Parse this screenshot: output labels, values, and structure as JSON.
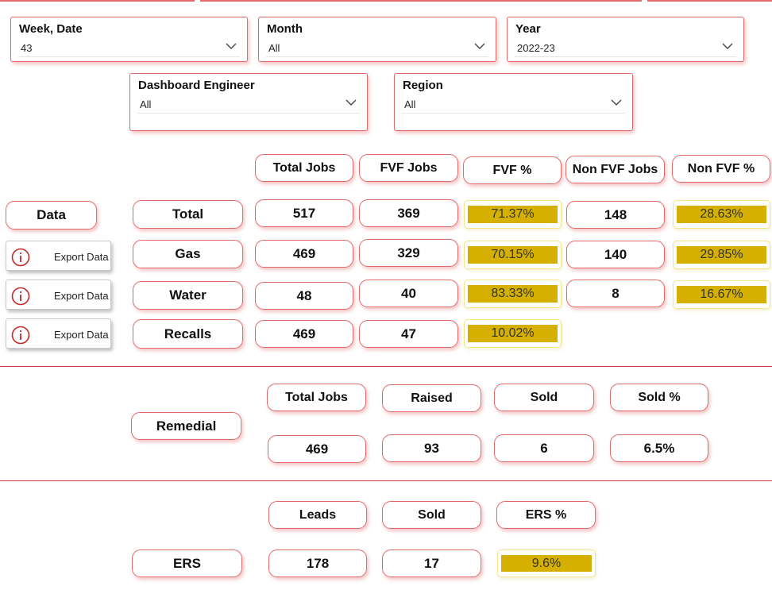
{
  "colors": {
    "accent_red": "#d33a3a",
    "pct_fill": "#d6b000"
  },
  "filters": {
    "week_date": {
      "label": "Week, Date",
      "value": "43"
    },
    "month": {
      "label": "Month",
      "value": "All"
    },
    "year": {
      "label": "Year",
      "value": "2022-23"
    },
    "dashboard_engineer": {
      "label": "Dashboard Engineer",
      "value": "All"
    },
    "region": {
      "label": "Region",
      "value": "All"
    }
  },
  "jobs_table": {
    "headers": {
      "total_jobs": "Total Jobs",
      "fvf_jobs": "FVF Jobs",
      "fvf_pct": "FVF %",
      "non_fvf_jobs": "Non FVF Jobs",
      "non_fvf_pct": "Non FVF %"
    },
    "data_label": "Data",
    "export_label": "Export Data",
    "rows": [
      {
        "label": "Total",
        "total_jobs": "517",
        "fvf_jobs": "369",
        "fvf_pct": "71.37%",
        "fvf_pct_value": 71.37,
        "non_fvf_jobs": "148",
        "non_fvf_pct": "28.63%",
        "non_fvf_pct_value": 28.63
      },
      {
        "label": "Gas",
        "total_jobs": "469",
        "fvf_jobs": "329",
        "fvf_pct": "70.15%",
        "fvf_pct_value": 70.15,
        "non_fvf_jobs": "140",
        "non_fvf_pct": "29.85%",
        "non_fvf_pct_value": 29.85
      },
      {
        "label": "Water",
        "total_jobs": "48",
        "fvf_jobs": "40",
        "fvf_pct": "83.33%",
        "fvf_pct_value": 83.33,
        "non_fvf_jobs": "8",
        "non_fvf_pct": "16.67%",
        "non_fvf_pct_value": 16.67
      },
      {
        "label": "Recalls",
        "total_jobs": "469",
        "fvf_jobs": "47",
        "fvf_pct": "10.02%",
        "fvf_pct_value": 10.02
      }
    ]
  },
  "remedial": {
    "label": "Remedial",
    "headers": {
      "total_jobs": "Total Jobs",
      "raised": "Raised",
      "sold": "Sold",
      "sold_pct": "Sold %"
    },
    "values": {
      "total_jobs": "469",
      "raised": "93",
      "sold": "6",
      "sold_pct": "6.5%"
    }
  },
  "ers": {
    "label": "ERS",
    "headers": {
      "leads": "Leads",
      "sold": "Sold",
      "ers_pct": "ERS %"
    },
    "values": {
      "leads": "178",
      "sold": "17",
      "ers_pct": "9.6%"
    }
  }
}
